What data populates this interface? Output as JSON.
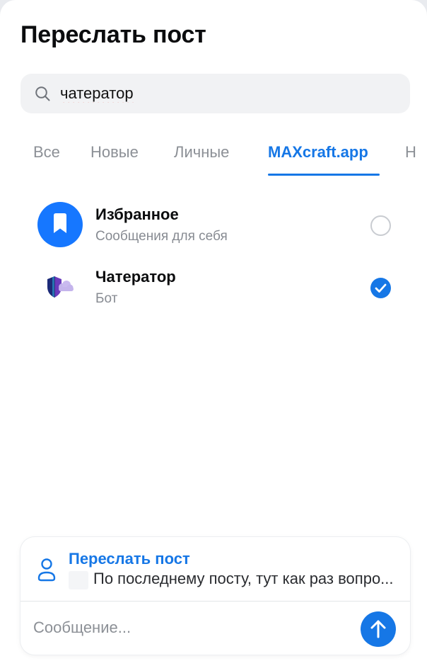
{
  "header": {
    "title": "Переслать пост"
  },
  "search": {
    "value": "чатератор",
    "icon": "search-icon"
  },
  "tabs": [
    {
      "label": "Все",
      "active": false
    },
    {
      "label": "Новые",
      "active": false
    },
    {
      "label": "Личные",
      "active": false
    },
    {
      "label": "MAXcraft.app",
      "active": true
    },
    {
      "label": "Н",
      "active": false
    }
  ],
  "contacts": [
    {
      "name": "Избранное",
      "subtitle": "Сообщения для себя",
      "selected": false,
      "icon": "bookmark-icon"
    },
    {
      "name": "Чатератор",
      "subtitle": "Бот",
      "selected": true,
      "icon": "shield-cloud-icon"
    }
  ],
  "compose": {
    "forward_title": "Переслать пост",
    "forward_preview": "По последнему посту, тут как раз вопрос по чату, как это работает?",
    "message_placeholder": "Сообщение...",
    "send_icon": "arrow-up-icon"
  },
  "colors": {
    "accent": "#1677e6",
    "favorite": "#1677ff",
    "muted": "#8c9096"
  }
}
